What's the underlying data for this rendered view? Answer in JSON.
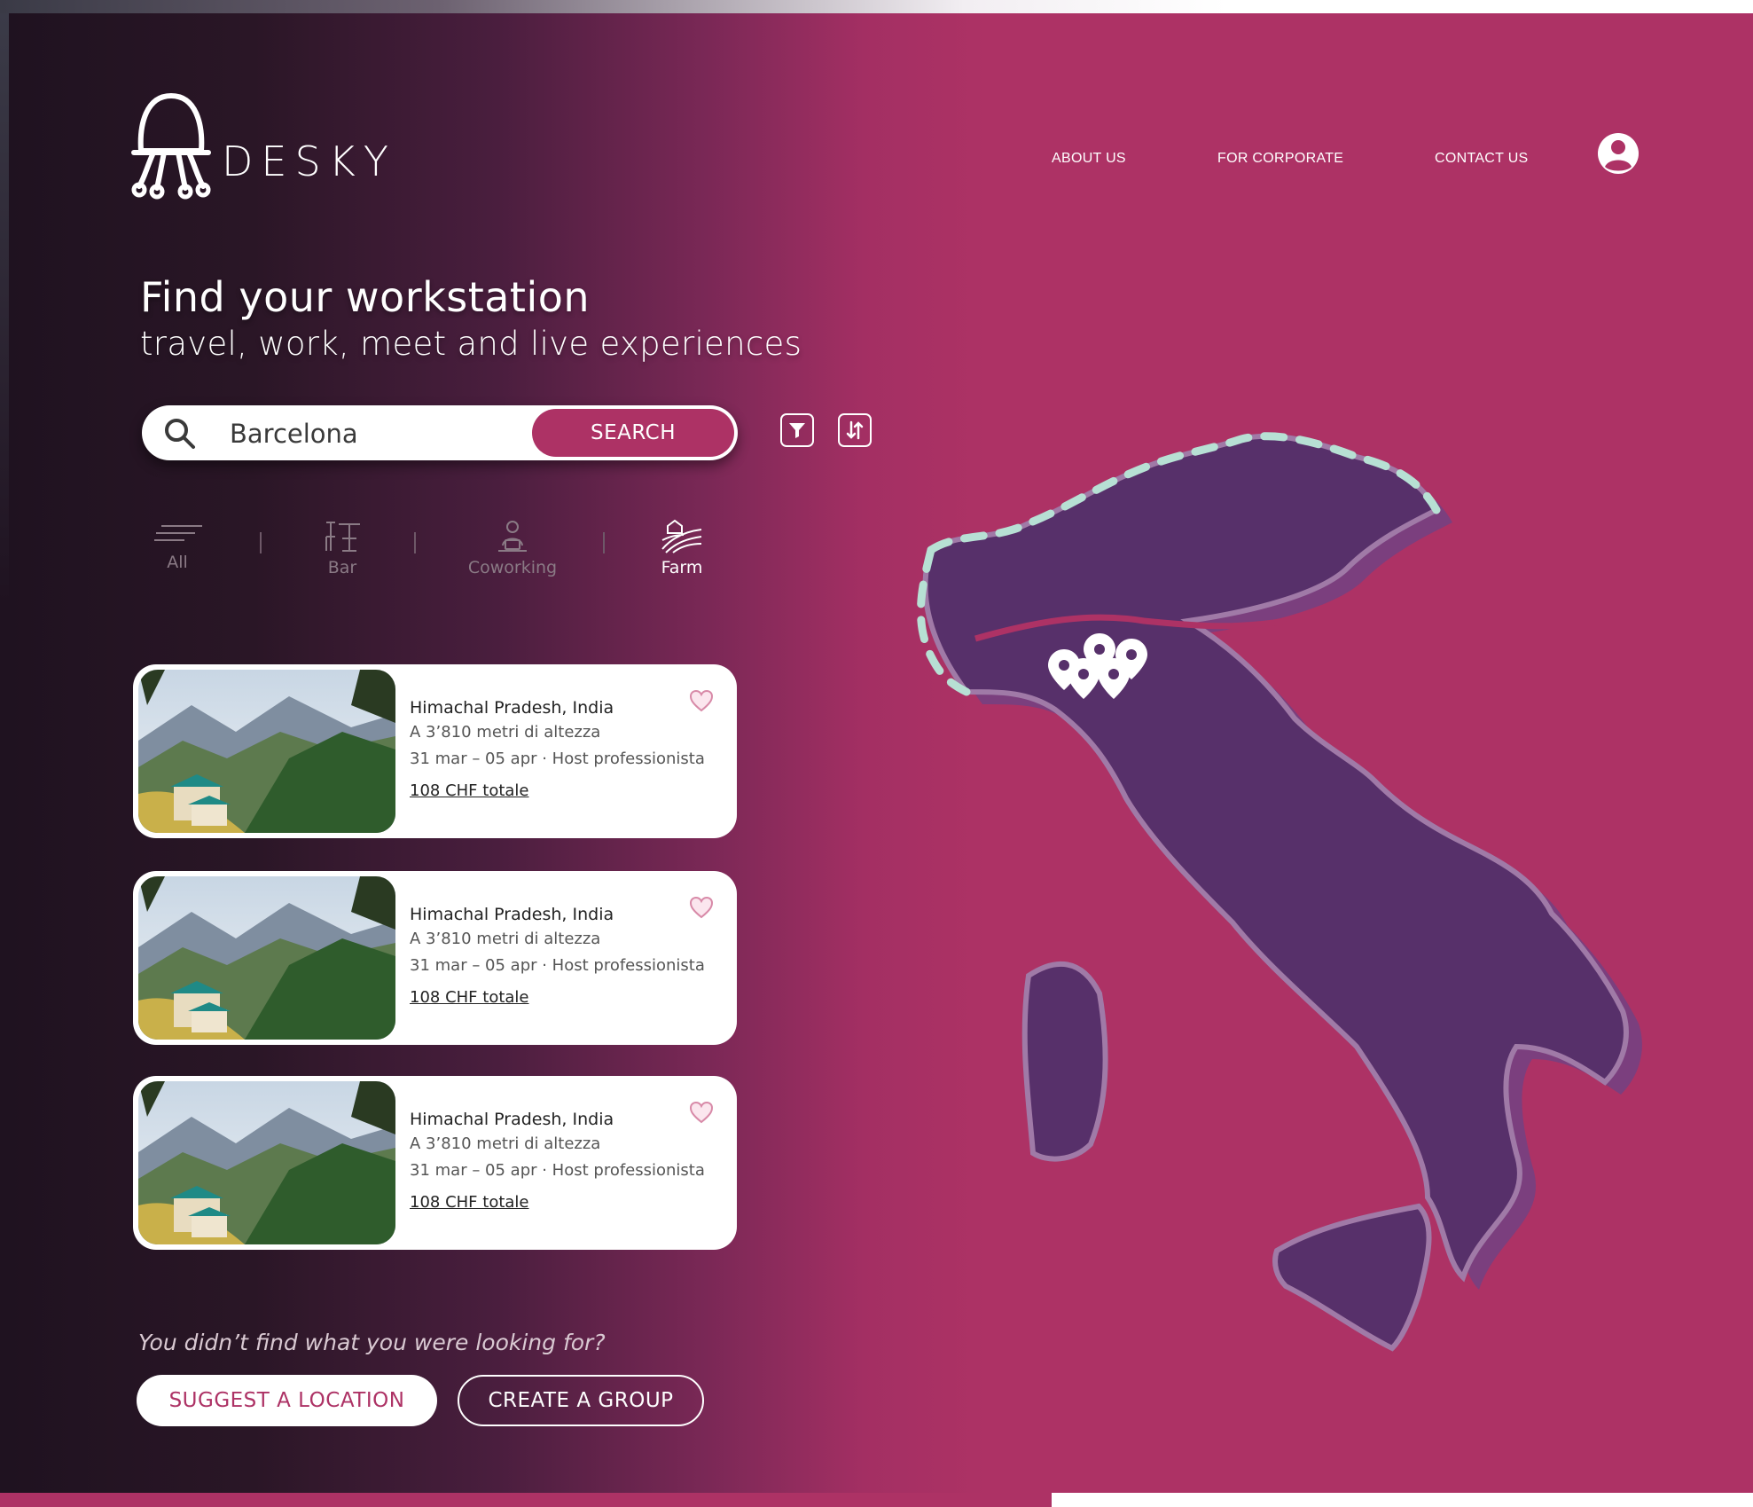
{
  "brand": {
    "name": "DESKY",
    "logo_icon": "jellyfish-lamp-icon"
  },
  "nav": {
    "about": "ABOUT US",
    "corporate": "FOR CORPORATE",
    "contact": "CONTACT US",
    "account_icon": "user-avatar-icon"
  },
  "hero": {
    "title": "Find your workstation",
    "subtitle": "travel, work, meet and live experiences"
  },
  "search": {
    "value": "Barcelona",
    "button_label": "SEARCH",
    "filter_icon": "filter-icon",
    "sort_icon": "sort-arrows-icon"
  },
  "categories": [
    {
      "label": "All",
      "icon": "lines-icon",
      "active": false
    },
    {
      "label": "Bar",
      "icon": "bar-stool-icon",
      "active": false
    },
    {
      "label": "Coworking",
      "icon": "desk-worker-icon",
      "active": false
    },
    {
      "label": "Farm",
      "icon": "farm-field-icon",
      "active": true
    }
  ],
  "listings": [
    {
      "title": "Himachal Pradesh, India",
      "altitude": "A 3’810 metri di altezza",
      "dates": "31 mar – 05 apr · Host professionista",
      "price": "108 CHF totale"
    },
    {
      "title": "Himachal Pradesh, India",
      "altitude": "A 3’810 metri di altezza",
      "dates": "31 mar – 05 apr · Host professionista",
      "price": "108 CHF totale"
    },
    {
      "title": "Himachal Pradesh, India",
      "altitude": "A 3’810 metri di altezza",
      "dates": "31 mar – 05 apr · Host professionista",
      "price": "108 CHF totale"
    }
  ],
  "footer": {
    "prompt": "You didn’t find what you were looking for?",
    "suggest_label": "SUGGEST A LOCATION",
    "group_label": "CREATE A GROUP"
  },
  "colors": {
    "accent": "#ad3265",
    "dark": "#1f1220",
    "map_fill": "#57306a",
    "map_coast": "#b7e0d4"
  }
}
